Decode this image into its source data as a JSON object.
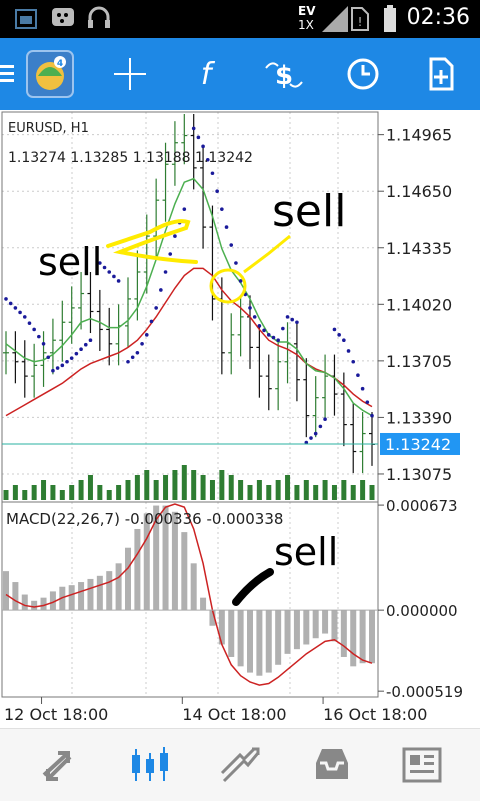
{
  "status_bar": {
    "time": "02:36",
    "network_badge": "EV",
    "signal_badge": "1X",
    "icons": [
      "gallery-icon",
      "bbm-icon",
      "headset-icon",
      "no-sim-icon",
      "battery-icon"
    ]
  },
  "toolbar": {
    "buttons": [
      "menu-icon",
      "app-logo-icon",
      "crosshair-icon",
      "function-icon",
      "trade-icon",
      "clock-icon",
      "add-document-icon"
    ]
  },
  "chart": {
    "symbol": "EURUSD, H1",
    "ohlc": "1.13274 1.13285 1.13188 1.13242",
    "price_ticks": [
      "1.14965",
      "1.14650",
      "1.14335",
      "1.14020",
      "1.13705",
      "1.13390",
      "1.13075"
    ],
    "current_price": "1.13242",
    "macd_label": "MACD(22,26,7) -0.000336 -0.000338",
    "macd_ticks": [
      "0.000673",
      "0.000000",
      "-0.000519"
    ],
    "time_labels": [
      "12 Oct 18:00",
      "14 Oct 18:00",
      "16 Oct 18:00"
    ],
    "annotations": [
      "sell",
      "sell",
      "sell"
    ]
  },
  "chart_data": {
    "type": "line",
    "symbol": "EURUSD",
    "timeframe": "H1",
    "price_ylim": [
      1.1293,
      1.1508
    ],
    "macd_ylim": [
      -0.00055,
      0.00068
    ],
    "close": [
      1.1375,
      1.137,
      1.1362,
      1.1368,
      1.1375,
      1.1382,
      1.1392,
      1.14,
      1.1408,
      1.1398,
      1.1388,
      1.138,
      1.139,
      1.1405,
      1.142,
      1.144,
      1.146,
      1.148,
      1.1492,
      1.1496,
      1.1478,
      1.1445,
      1.1405,
      1.1375,
      1.1385,
      1.1395,
      1.1378,
      1.1362,
      1.1355,
      1.137,
      1.138,
      1.136,
      1.134,
      1.135,
      1.1362,
      1.1352,
      1.1335,
      1.132,
      1.133,
      1.1324
    ],
    "ema_fast": [
      1.138,
      1.1376,
      1.1372,
      1.137,
      1.1371,
      1.1374,
      1.1379,
      1.1385,
      1.1392,
      1.1394,
      1.1392,
      1.1389,
      1.1389,
      1.1393,
      1.14,
      1.1412,
      1.1427,
      1.1443,
      1.1458,
      1.147,
      1.1472,
      1.1466,
      1.1451,
      1.1433,
      1.1421,
      1.1414,
      1.1405,
      1.1394,
      1.1385,
      1.1381,
      1.1381,
      1.1377,
      1.1369,
      1.1365,
      1.1364,
      1.1361,
      1.1355,
      1.1347,
      1.1343,
      1.134
    ],
    "ema_slow": [
      1.134,
      1.1343,
      1.1346,
      1.1349,
      1.1352,
      1.1355,
      1.1358,
      1.1362,
      1.1366,
      1.1369,
      1.1371,
      1.1373,
      1.1375,
      1.1378,
      1.1382,
      1.1388,
      1.1395,
      1.1403,
      1.1411,
      1.1418,
      1.1422,
      1.1422,
      1.1418,
      1.141,
      1.1404,
      1.14,
      1.1395,
      1.1388,
      1.1382,
      1.1379,
      1.1377,
      1.1374,
      1.1369,
      1.1366,
      1.1364,
      1.1361,
      1.1357,
      1.1352,
      1.1348,
      1.1345
    ],
    "sar": [
      1.1405,
      1.14,
      1.1395,
      1.1388,
      1.138,
      1.1365,
      1.1368,
      1.1372,
      1.1377,
      1.1382,
      1.1425,
      1.142,
      1.1415,
      1.137,
      1.1375,
      1.1385,
      1.14,
      1.142,
      1.144,
      1.1455,
      1.15,
      1.149,
      1.1475,
      1.1455,
      1.1435,
      1.1415,
      1.14,
      1.139,
      1.1385,
      1.1382,
      1.1395,
      1.1392,
      1.1325,
      1.133,
      1.1338,
      1.1388,
      1.1382,
      1.137,
      1.1355,
      1.134
    ],
    "volume": [
      2,
      3,
      2,
      3,
      4,
      3,
      2,
      3,
      4,
      5,
      3,
      2,
      3,
      4,
      5,
      6,
      4,
      5,
      6,
      7,
      6,
      5,
      4,
      6,
      5,
      4,
      3,
      4,
      3,
      4,
      5,
      3,
      4,
      3,
      4,
      3,
      4,
      3,
      4,
      3
    ],
    "macd_hist": [
      0.00025,
      0.00018,
      0.0001,
      6e-05,
      8e-05,
      0.00012,
      0.00015,
      0.00016,
      0.00018,
      0.0002,
      0.00022,
      0.00025,
      0.0003,
      0.0004,
      0.00052,
      0.00062,
      0.00067,
      0.00067,
      0.00063,
      0.0005,
      0.0003,
      8e-05,
      -0.0001,
      -0.00022,
      -0.0003,
      -0.00036,
      -0.0004,
      -0.00042,
      -0.0004,
      -0.00035,
      -0.00028,
      -0.00025,
      -0.00022,
      -0.00018,
      -0.00015,
      -0.0002,
      -0.0003,
      -0.00036,
      -0.00034,
      -0.00034
    ],
    "macd_signal": [
      0.0001,
      6e-05,
      3e-05,
      2e-05,
      3e-05,
      5e-05,
      8e-05,
      0.0001,
      0.00012,
      0.00014,
      0.00016,
      0.00018,
      0.00021,
      0.00027,
      0.00036,
      0.00046,
      0.00058,
      0.00066,
      0.00068,
      0.00066,
      0.00052,
      0.0003,
      0.0,
      -0.00022,
      -0.00035,
      -0.00042,
      -0.00046,
      -0.00048,
      -0.00047,
      -0.00043,
      -0.00038,
      -0.00033,
      -0.00028,
      -0.00024,
      -0.0002,
      -0.00019,
      -0.00023,
      -0.00028,
      -0.00032,
      -0.00034
    ]
  },
  "colors": {
    "toolbar_bg": "#1e88e5",
    "bull_line": "#2e7d32",
    "ema_fast": "#4caf50",
    "ema_slow": "#cc2222",
    "sar": "#1a1a9a",
    "macd_hist": "#b0b0b0",
    "current_price_bg": "#2196f3",
    "annotation_yellow": "#ffeb00"
  },
  "bottom_nav": {
    "tabs": [
      "quotes-icon",
      "chart-icon",
      "trade-icon",
      "history-icon",
      "news-icon"
    ],
    "active": "chart-icon"
  }
}
